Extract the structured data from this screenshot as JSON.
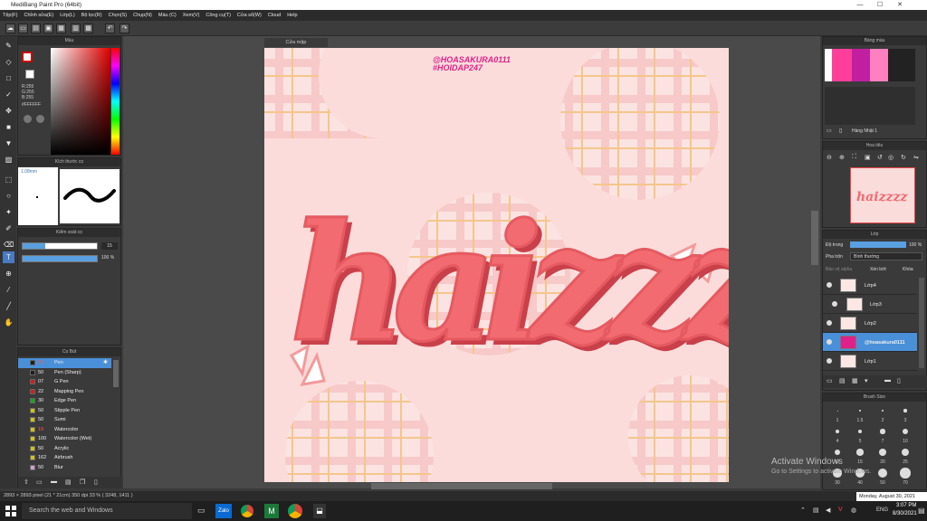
{
  "window": {
    "title": "MediBang Paint Pro (64bit)"
  },
  "menu": [
    "Tệp(F)",
    "Chỉnh sửa(E)",
    "Lớp(L)",
    "Bộ lọc(R)",
    "Chọn(S)",
    "Chụp(N)",
    "Màu (C)",
    "Xem(V)",
    "Công cụ(T)",
    "Cửa sổ(W)",
    "Cloud",
    "Help"
  ],
  "color_panel": {
    "title": "Màu",
    "r": "R:255",
    "g": "G:255",
    "b": "B:255",
    "hex": "#FFFFFF"
  },
  "brush_size_panel": {
    "title": "Kích thước cọ",
    "size": "1.08mm"
  },
  "brush_control_panel": {
    "title": "Kiểm soát cọ",
    "size_value": "15",
    "opacity_value": "100 %"
  },
  "brush_panel": {
    "title": "Cọ Bút",
    "items": [
      {
        "size": "15",
        "name": "Pen",
        "color": "#1f1f1f"
      },
      {
        "size": "50",
        "name": "Pen (Sharp)",
        "color": "#1f1f1f"
      },
      {
        "size": "07",
        "name": "G Pen",
        "color": "#cc2020"
      },
      {
        "size": "22",
        "name": "Mapping Pen",
        "color": "#cc2020"
      },
      {
        "size": "30",
        "name": "Edge Pen",
        "color": "#20a020"
      },
      {
        "size": "50",
        "name": "Stipple Pen",
        "color": "#d0c020"
      },
      {
        "size": "50",
        "name": "Sumi",
        "color": "#d0c020"
      },
      {
        "size": "19",
        "name": "Watercolor",
        "color": "#d0c020"
      },
      {
        "size": "100",
        "name": "Watercolor (Wet)",
        "color": "#d0c020"
      },
      {
        "size": "50",
        "name": "Acrylic",
        "color": "#d0c020"
      },
      {
        "size": "162",
        "name": "Airbrush",
        "color": "#d0c020"
      },
      {
        "size": "50",
        "name": "Blur",
        "color": "#d0a0d0"
      }
    ]
  },
  "canvas": {
    "tab": "Cửa mập",
    "tag1": "@HOASAKURA0111",
    "tag2": "#HOIDAP247",
    "lettering": "haizzzz"
  },
  "palette_panel": {
    "title": "Bảng màu",
    "name": "Hàng Nhật 1"
  },
  "navigator_panel": {
    "title": "Hoa tiêu"
  },
  "layer_panel": {
    "title": "Lớp",
    "opacity_label": "Độ trong",
    "opacity_value": "100 %",
    "blend_label": "Pha trộn",
    "blend_value": "Bình thường",
    "protect_alpha": "Bảo vệ alpha",
    "clip": "Xén bớt",
    "lock": "Khóa",
    "layers": [
      {
        "name": "Lớp4"
      },
      {
        "name": "Lớp3"
      },
      {
        "name": "Lớp2"
      },
      {
        "name": "@hoasakura0111"
      },
      {
        "name": "Lớp1"
      }
    ]
  },
  "brush_size_grid": {
    "title": "Brush Size",
    "labels": [
      "1",
      "1.5",
      "2",
      "3",
      "4",
      "5",
      "7",
      "10",
      "12",
      "15",
      "20",
      "25",
      "30",
      "40",
      "50",
      "70"
    ]
  },
  "status_bar": {
    "text": "2893 × 2893 pixel (21 * 21cm) 350 dpi  33 %  ( 3248, 1411 )"
  },
  "watermark": {
    "line1": "Activate Windows",
    "line2": "Go to Settings to activate Windows."
  },
  "taskbar": {
    "search": "Search the web and Windows",
    "date_tooltip": "Monday, August 30, 2021",
    "time": "3:07 PM",
    "date": "8/30/2021",
    "lang": "ENG"
  }
}
